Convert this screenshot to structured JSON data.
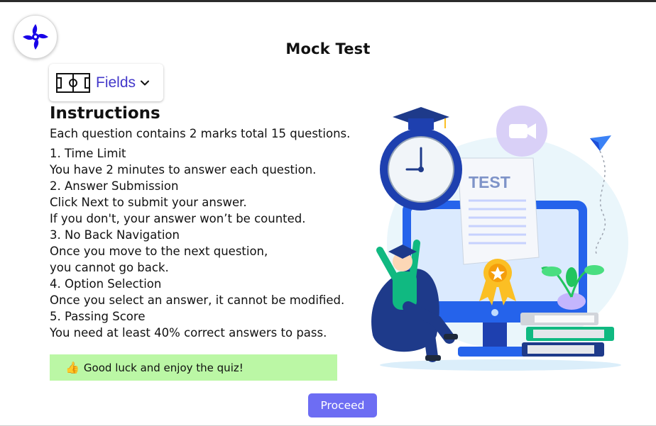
{
  "header": {
    "title": "Mock Test"
  },
  "logo": {
    "icon": "shuriken-icon",
    "color": "#1800e8"
  },
  "fields_dropdown": {
    "icon": "field-pitch-icon",
    "label": "Fields",
    "chevron_icon": "chevron-down-icon",
    "label_color": "#4338ca"
  },
  "instructions": {
    "heading": "Instructions",
    "intro": "Each question contains 2 marks total 15 questions.",
    "lines": [
      "1. Time Limit",
      "You have 2 minutes to answer each question.",
      "2. Answer Submission",
      "Click Next to submit your answer.",
      "If you don't, your answer won’t be counted.",
      "3. No Back Navigation",
      "Once you move to the next question,",
      "you cannot go back.",
      "4. Option Selection",
      "Once you select an answer, it cannot be modified.",
      "5. Passing Score",
      "You need at least 40% correct answers to pass."
    ]
  },
  "good_luck": {
    "icon": "thumbs-up-icon",
    "text": "Good luck and enjoy the quiz!",
    "background": "#bbf7a5"
  },
  "proceed_button": {
    "label": "Proceed",
    "color": "#6d6df3"
  },
  "illustration": {
    "test_sheet_label": "TEST"
  }
}
